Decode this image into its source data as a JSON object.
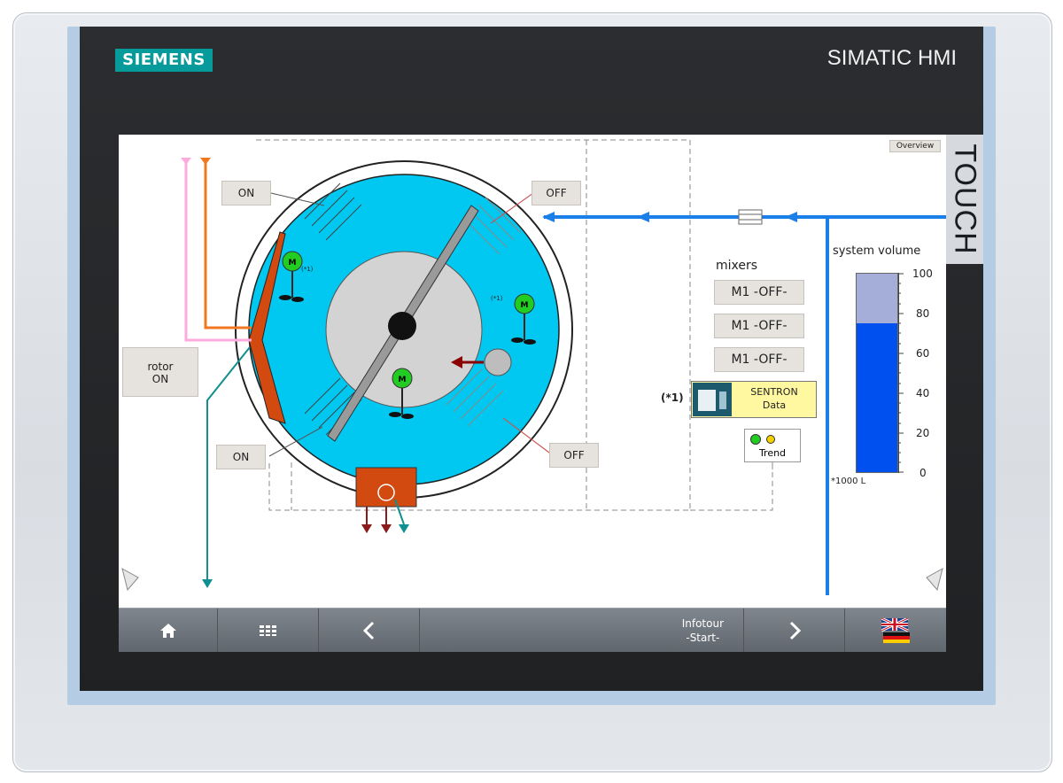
{
  "device": {
    "logo": "SIEMENS",
    "brand": "SIMATIC HMI",
    "touch_label": "TOUCH"
  },
  "screen": {
    "overview_button": "Overview",
    "valve_labels": {
      "top_left": "ON",
      "top_right": "OFF",
      "bottom_left": "ON",
      "bottom_right": "OFF"
    },
    "rotor_button": {
      "line1": "rotor",
      "line2": "ON"
    },
    "motor_symbol": "M",
    "footnote_marker": "(*1)",
    "mixers": {
      "title": "mixers",
      "buttons": [
        "M1 -OFF-",
        "M1 -OFF-",
        "M1 -OFF-"
      ]
    },
    "sentron": {
      "marker": "(*1)",
      "line1": "SENTRON",
      "line2": "Data"
    },
    "trend_button": "Trend",
    "system_volume": {
      "title": "system volume",
      "unit": "*1000 L",
      "ticks": [
        "100",
        "80",
        "60",
        "40",
        "20",
        "0"
      ],
      "level_fraction": 0.75,
      "setpoint_fraction": 1.0
    }
  },
  "navbar": {
    "home_icon": "home-icon",
    "menu_icon": "grid-menu-icon",
    "back_icon": "chevron-left-icon",
    "infotour": {
      "line1": "Infotour",
      "line2": "-Start-"
    },
    "next_icon": "chevron-right-icon",
    "language_icon": "uk-germany-flag-icon"
  },
  "colors": {
    "tank": "#00c8f0",
    "volume_fill": "#0050f0",
    "volume_empty": "#a5add9",
    "pipe_blue": "#1a7fe8",
    "pipe_orange": "#f07820",
    "pipe_pink": "#ffaadd",
    "pipe_teal": "#109090",
    "scraper": "#d24a10",
    "brand_teal": "#079a9a"
  }
}
